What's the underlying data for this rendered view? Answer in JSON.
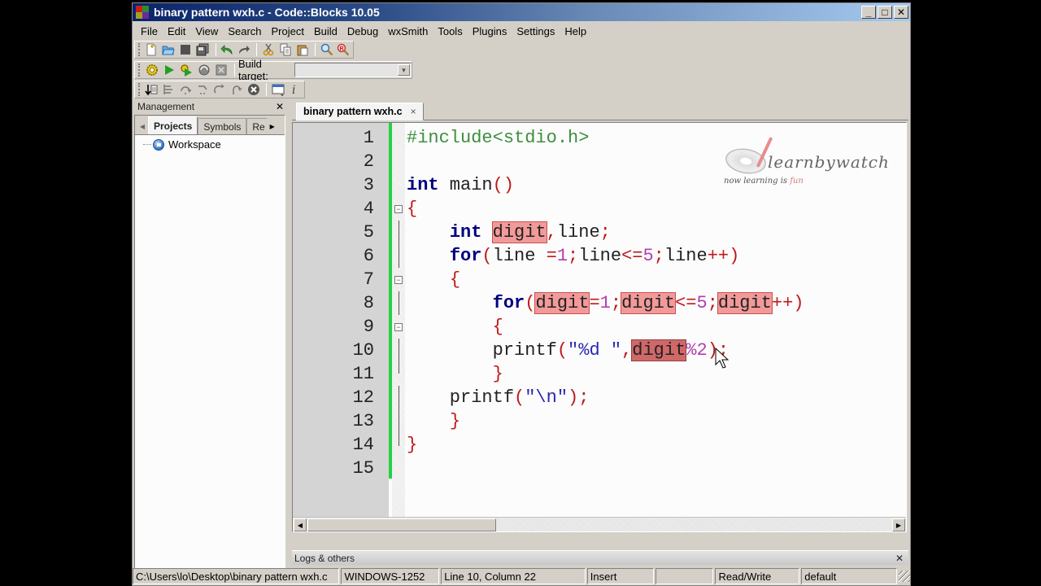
{
  "window": {
    "title": "binary pattern wxh.c - Code::Blocks 10.05",
    "buttons": {
      "minimize": "_",
      "maximize": "□",
      "close": "✕"
    }
  },
  "menu": [
    "File",
    "Edit",
    "View",
    "Search",
    "Project",
    "Build",
    "Debug",
    "wxSmith",
    "Tools",
    "Plugins",
    "Settings",
    "Help"
  ],
  "toolbar_main": {
    "icons": [
      "new-file-icon",
      "open-icon",
      "save-icon",
      "save-all-icon",
      "undo-icon",
      "redo-icon",
      "cut-icon",
      "copy-icon",
      "paste-icon",
      "find-icon",
      "replace-icon"
    ]
  },
  "toolbar_build": {
    "icons": [
      "build-icon",
      "run-icon",
      "build-run-icon",
      "rebuild-icon",
      "abort-icon"
    ],
    "build_target_label": "Build target:",
    "build_target_value": ""
  },
  "toolbar_debug": {
    "icons": [
      "debug-icon",
      "run-to-cursor-icon",
      "next-line-icon",
      "step-into-icon",
      "step-out-icon",
      "next-instruction-icon",
      "stop-debug-icon",
      "debug-windows-icon",
      "info-icon"
    ]
  },
  "management": {
    "title": "Management",
    "close": "✕",
    "tabs": [
      "Projects",
      "Symbols",
      "Re"
    ],
    "active_tab": "Projects",
    "tree": [
      {
        "label": "Workspace",
        "icon": "workspace-icon"
      }
    ]
  },
  "editor": {
    "tab_label": "binary pattern wxh.c",
    "tab_close": "×",
    "line_numbers": [
      "1",
      "2",
      "3",
      "4",
      "5",
      "6",
      "7",
      "8",
      "9",
      "10",
      "11",
      "12",
      "13",
      "14",
      "15"
    ],
    "code_lines": [
      "#include<stdio.h>",
      "",
      "int main()",
      "{",
      "    int digit,line;",
      "    for(line =1;line<=5;line++)",
      "    {",
      "        for(digit=1;digit<=5;digit++)",
      "        {",
      "        printf(\"%d \",digit%2);",
      "        }",
      "    printf(\"\\n\");",
      "    }",
      "}",
      ""
    ],
    "highlighted_word": "digit",
    "cursor": {
      "line": 10,
      "column": 22
    }
  },
  "watermark": {
    "brand": "learnbywatch",
    "tagline_a": "now learning is ",
    "tagline_b": "fun"
  },
  "logs": {
    "title": "Logs & others",
    "close": "✕"
  },
  "status": {
    "file_path": "C:\\Users\\lo\\Desktop\\binary pattern wxh.c",
    "encoding": "WINDOWS-1252",
    "position": "Line 10, Column 22",
    "mode": "Insert",
    "blank": "",
    "access": "Read/Write",
    "profile": "default"
  },
  "colors": {
    "keyword": "#00007f",
    "preprocessor": "#3e8e3e",
    "operator": "#c01818",
    "number": "#b040b0",
    "string": "#2a2ab0",
    "highlight": "#f29a9a",
    "change_bar": "#22d244"
  }
}
